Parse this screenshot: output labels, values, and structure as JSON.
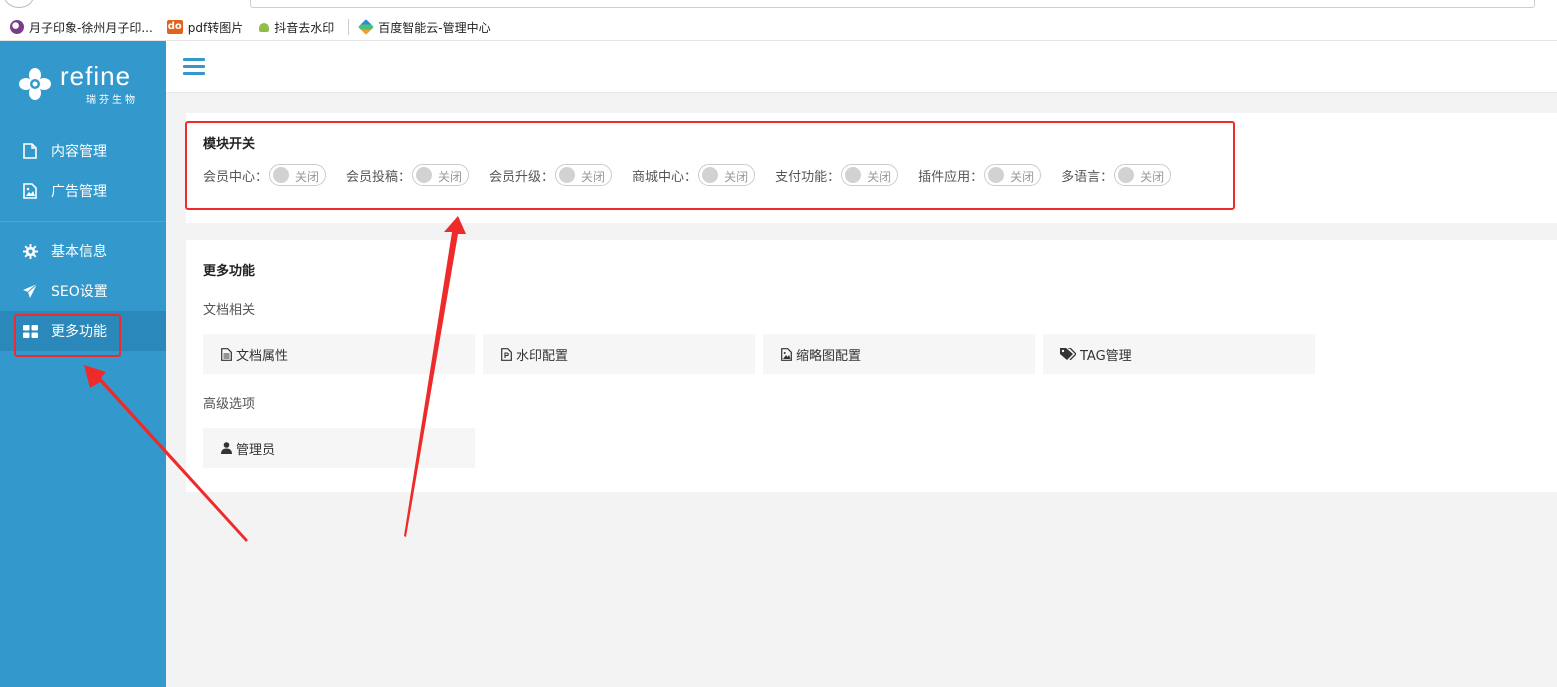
{
  "bookmarks": [
    {
      "label": "月子印象-徐州月子印...",
      "icon": "yuezi-logo-icon"
    },
    {
      "label": "pdf转图片",
      "icon": "do-icon",
      "icon_text": "do"
    },
    {
      "label": "抖音去水印",
      "icon": "android-icon"
    },
    {
      "label": "百度智能云-管理中心",
      "icon": "baidu-cloud-icon"
    }
  ],
  "logo": {
    "name": "refine",
    "sub": "瑞芬生物"
  },
  "sidebar": {
    "items": [
      {
        "label": "内容管理",
        "icon": "file-icon"
      },
      {
        "label": "广告管理",
        "icon": "image-icon"
      },
      {
        "label": "基本信息",
        "icon": "gear-icon"
      },
      {
        "label": "SEO设置",
        "icon": "paper-plane-icon"
      },
      {
        "label": "更多功能",
        "icon": "grid-icon",
        "active": true
      }
    ]
  },
  "header": {
    "menu_icon": "hamburger-icon"
  },
  "modules": {
    "title": "模块开关",
    "switches": [
      {
        "label": "会员中心：",
        "state": "关闭"
      },
      {
        "label": "会员投稿：",
        "state": "关闭"
      },
      {
        "label": "会员升级：",
        "state": "关闭"
      },
      {
        "label": "商城中心：",
        "state": "关闭"
      },
      {
        "label": "支付功能：",
        "state": "关闭"
      },
      {
        "label": "插件应用：",
        "state": "关闭"
      },
      {
        "label": "多语言：",
        "state": "关闭"
      }
    ]
  },
  "more": {
    "title": "更多功能",
    "doc_section": "文档相关",
    "doc_buttons": [
      {
        "label": "文档属性",
        "icon": "file-text-icon"
      },
      {
        "label": "水印配置",
        "icon": "file-p-icon"
      },
      {
        "label": "缩略图配置",
        "icon": "image-icon"
      },
      {
        "label": "TAG管理",
        "icon": "tags-icon"
      }
    ],
    "adv_section": "高级选项",
    "adv_buttons": [
      {
        "label": "管理员",
        "icon": "user-icon"
      }
    ]
  },
  "colors": {
    "sidebar": "#3399cc",
    "annotation": "#ee2a2a"
  }
}
